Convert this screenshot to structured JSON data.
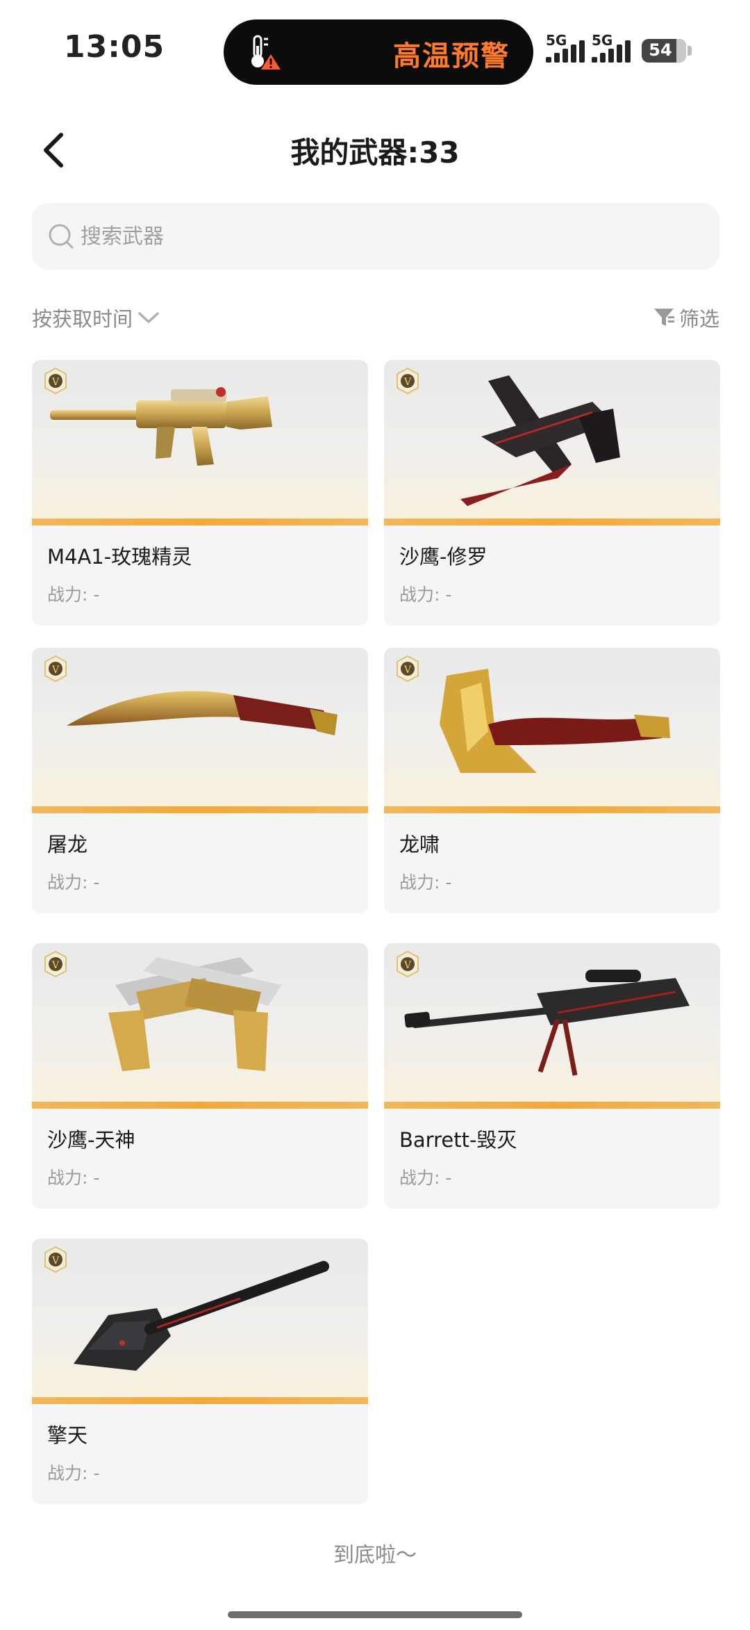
{
  "status_bar": {
    "time": "13:05",
    "alert_text": "高温预警",
    "network1": "5G",
    "network2": "5G",
    "battery": "54"
  },
  "header": {
    "title": "我的武器:33"
  },
  "search": {
    "placeholder": "搜索武器"
  },
  "sort": {
    "label": "按获取时间"
  },
  "filter": {
    "label": "筛选"
  },
  "weapons": [
    {
      "name": "M4A1-玫瑰精灵",
      "power": "战力: -",
      "badge": "V",
      "icon": "rifle-icon"
    },
    {
      "name": "沙鹰-修罗",
      "power": "战力: -",
      "badge": "V",
      "icon": "pistol-knife-icon"
    },
    {
      "name": "屠龙",
      "power": "战力: -",
      "badge": "V",
      "icon": "kukri-icon"
    },
    {
      "name": "龙啸",
      "power": "战力: -",
      "badge": "V",
      "icon": "axe-icon"
    },
    {
      "name": "沙鹰-天神",
      "power": "战力: -",
      "badge": "V",
      "icon": "dual-pistols-icon"
    },
    {
      "name": "Barrett-毁灭",
      "power": "战力: -",
      "badge": "V",
      "icon": "sniper-rifle-icon"
    },
    {
      "name": "擎天",
      "power": "战力: -",
      "badge": "V",
      "icon": "shovel-icon"
    }
  ],
  "footer": {
    "end_text": "到底啦～"
  },
  "colors": {
    "accent": "#ff7a2a",
    "card_bar": "#f3a93a",
    "card_bg": "#f5f5f5"
  }
}
